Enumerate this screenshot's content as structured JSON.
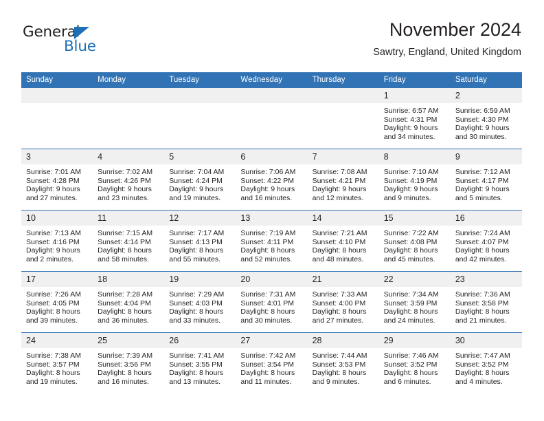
{
  "brand": {
    "name_part1": "General",
    "name_part2": "Blue",
    "triangle_color": "#1d70b7",
    "text_color": "#231f20"
  },
  "header": {
    "title": "November 2024",
    "subtitle": "Sawtry, England, United Kingdom"
  },
  "theme": {
    "header_blue": "#3173b5",
    "daynum_band": "#f0f0f0",
    "text": "#231f20"
  },
  "weekday_headers": [
    "Sunday",
    "Monday",
    "Tuesday",
    "Wednesday",
    "Thursday",
    "Friday",
    "Saturday"
  ],
  "weeks": [
    [
      {
        "day": "",
        "sunrise": "",
        "sunset": "",
        "daylight1": "",
        "daylight2": "",
        "empty": true
      },
      {
        "day": "",
        "sunrise": "",
        "sunset": "",
        "daylight1": "",
        "daylight2": "",
        "empty": true
      },
      {
        "day": "",
        "sunrise": "",
        "sunset": "",
        "daylight1": "",
        "daylight2": "",
        "empty": true
      },
      {
        "day": "",
        "sunrise": "",
        "sunset": "",
        "daylight1": "",
        "daylight2": "",
        "empty": true
      },
      {
        "day": "",
        "sunrise": "",
        "sunset": "",
        "daylight1": "",
        "daylight2": "",
        "empty": true
      },
      {
        "day": "1",
        "sunrise": "Sunrise: 6:57 AM",
        "sunset": "Sunset: 4:31 PM",
        "daylight1": "Daylight: 9 hours",
        "daylight2": "and 34 minutes."
      },
      {
        "day": "2",
        "sunrise": "Sunrise: 6:59 AM",
        "sunset": "Sunset: 4:30 PM",
        "daylight1": "Daylight: 9 hours",
        "daylight2": "and 30 minutes."
      }
    ],
    [
      {
        "day": "3",
        "sunrise": "Sunrise: 7:01 AM",
        "sunset": "Sunset: 4:28 PM",
        "daylight1": "Daylight: 9 hours",
        "daylight2": "and 27 minutes."
      },
      {
        "day": "4",
        "sunrise": "Sunrise: 7:02 AM",
        "sunset": "Sunset: 4:26 PM",
        "daylight1": "Daylight: 9 hours",
        "daylight2": "and 23 minutes."
      },
      {
        "day": "5",
        "sunrise": "Sunrise: 7:04 AM",
        "sunset": "Sunset: 4:24 PM",
        "daylight1": "Daylight: 9 hours",
        "daylight2": "and 19 minutes."
      },
      {
        "day": "6",
        "sunrise": "Sunrise: 7:06 AM",
        "sunset": "Sunset: 4:22 PM",
        "daylight1": "Daylight: 9 hours",
        "daylight2": "and 16 minutes."
      },
      {
        "day": "7",
        "sunrise": "Sunrise: 7:08 AM",
        "sunset": "Sunset: 4:21 PM",
        "daylight1": "Daylight: 9 hours",
        "daylight2": "and 12 minutes."
      },
      {
        "day": "8",
        "sunrise": "Sunrise: 7:10 AM",
        "sunset": "Sunset: 4:19 PM",
        "daylight1": "Daylight: 9 hours",
        "daylight2": "and 9 minutes."
      },
      {
        "day": "9",
        "sunrise": "Sunrise: 7:12 AM",
        "sunset": "Sunset: 4:17 PM",
        "daylight1": "Daylight: 9 hours",
        "daylight2": "and 5 minutes."
      }
    ],
    [
      {
        "day": "10",
        "sunrise": "Sunrise: 7:13 AM",
        "sunset": "Sunset: 4:16 PM",
        "daylight1": "Daylight: 9 hours",
        "daylight2": "and 2 minutes."
      },
      {
        "day": "11",
        "sunrise": "Sunrise: 7:15 AM",
        "sunset": "Sunset: 4:14 PM",
        "daylight1": "Daylight: 8 hours",
        "daylight2": "and 58 minutes."
      },
      {
        "day": "12",
        "sunrise": "Sunrise: 7:17 AM",
        "sunset": "Sunset: 4:13 PM",
        "daylight1": "Daylight: 8 hours",
        "daylight2": "and 55 minutes."
      },
      {
        "day": "13",
        "sunrise": "Sunrise: 7:19 AM",
        "sunset": "Sunset: 4:11 PM",
        "daylight1": "Daylight: 8 hours",
        "daylight2": "and 52 minutes."
      },
      {
        "day": "14",
        "sunrise": "Sunrise: 7:21 AM",
        "sunset": "Sunset: 4:10 PM",
        "daylight1": "Daylight: 8 hours",
        "daylight2": "and 48 minutes."
      },
      {
        "day": "15",
        "sunrise": "Sunrise: 7:22 AM",
        "sunset": "Sunset: 4:08 PM",
        "daylight1": "Daylight: 8 hours",
        "daylight2": "and 45 minutes."
      },
      {
        "day": "16",
        "sunrise": "Sunrise: 7:24 AM",
        "sunset": "Sunset: 4:07 PM",
        "daylight1": "Daylight: 8 hours",
        "daylight2": "and 42 minutes."
      }
    ],
    [
      {
        "day": "17",
        "sunrise": "Sunrise: 7:26 AM",
        "sunset": "Sunset: 4:05 PM",
        "daylight1": "Daylight: 8 hours",
        "daylight2": "and 39 minutes."
      },
      {
        "day": "18",
        "sunrise": "Sunrise: 7:28 AM",
        "sunset": "Sunset: 4:04 PM",
        "daylight1": "Daylight: 8 hours",
        "daylight2": "and 36 minutes."
      },
      {
        "day": "19",
        "sunrise": "Sunrise: 7:29 AM",
        "sunset": "Sunset: 4:03 PM",
        "daylight1": "Daylight: 8 hours",
        "daylight2": "and 33 minutes."
      },
      {
        "day": "20",
        "sunrise": "Sunrise: 7:31 AM",
        "sunset": "Sunset: 4:01 PM",
        "daylight1": "Daylight: 8 hours",
        "daylight2": "and 30 minutes."
      },
      {
        "day": "21",
        "sunrise": "Sunrise: 7:33 AM",
        "sunset": "Sunset: 4:00 PM",
        "daylight1": "Daylight: 8 hours",
        "daylight2": "and 27 minutes."
      },
      {
        "day": "22",
        "sunrise": "Sunrise: 7:34 AM",
        "sunset": "Sunset: 3:59 PM",
        "daylight1": "Daylight: 8 hours",
        "daylight2": "and 24 minutes."
      },
      {
        "day": "23",
        "sunrise": "Sunrise: 7:36 AM",
        "sunset": "Sunset: 3:58 PM",
        "daylight1": "Daylight: 8 hours",
        "daylight2": "and 21 minutes."
      }
    ],
    [
      {
        "day": "24",
        "sunrise": "Sunrise: 7:38 AM",
        "sunset": "Sunset: 3:57 PM",
        "daylight1": "Daylight: 8 hours",
        "daylight2": "and 19 minutes."
      },
      {
        "day": "25",
        "sunrise": "Sunrise: 7:39 AM",
        "sunset": "Sunset: 3:56 PM",
        "daylight1": "Daylight: 8 hours",
        "daylight2": "and 16 minutes."
      },
      {
        "day": "26",
        "sunrise": "Sunrise: 7:41 AM",
        "sunset": "Sunset: 3:55 PM",
        "daylight1": "Daylight: 8 hours",
        "daylight2": "and 13 minutes."
      },
      {
        "day": "27",
        "sunrise": "Sunrise: 7:42 AM",
        "sunset": "Sunset: 3:54 PM",
        "daylight1": "Daylight: 8 hours",
        "daylight2": "and 11 minutes."
      },
      {
        "day": "28",
        "sunrise": "Sunrise: 7:44 AM",
        "sunset": "Sunset: 3:53 PM",
        "daylight1": "Daylight: 8 hours",
        "daylight2": "and 9 minutes."
      },
      {
        "day": "29",
        "sunrise": "Sunrise: 7:46 AM",
        "sunset": "Sunset: 3:52 PM",
        "daylight1": "Daylight: 8 hours",
        "daylight2": "and 6 minutes."
      },
      {
        "day": "30",
        "sunrise": "Sunrise: 7:47 AM",
        "sunset": "Sunset: 3:52 PM",
        "daylight1": "Daylight: 8 hours",
        "daylight2": "and 4 minutes."
      }
    ]
  ]
}
